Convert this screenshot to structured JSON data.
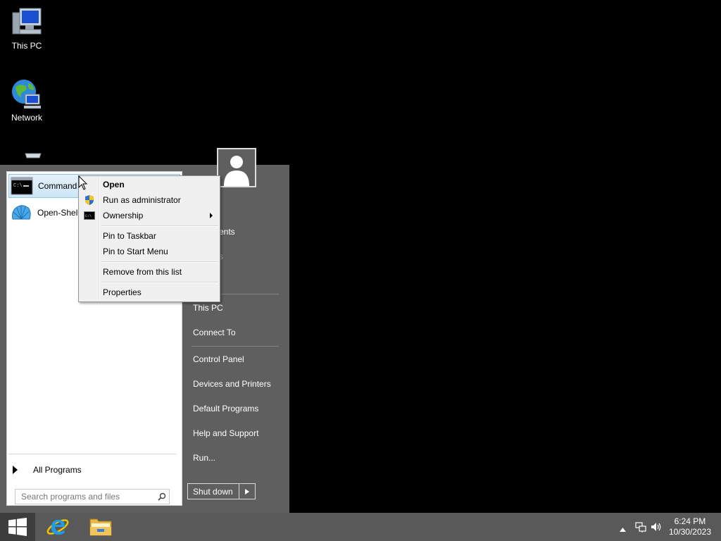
{
  "desktop": {
    "icons": [
      {
        "label": "This PC",
        "icon": "computer-icon"
      },
      {
        "label": "Network",
        "icon": "network-globe-icon"
      },
      {
        "label": "",
        "icon": "recycle-bin-icon"
      }
    ]
  },
  "start_menu": {
    "programs": [
      {
        "label": "Command",
        "icon": "command-prompt-icon",
        "selected": true
      },
      {
        "label": "Open-Shell",
        "icon": "open-shell-icon",
        "selected": false
      }
    ],
    "all_programs": "All Programs",
    "search": {
      "placeholder": "Search programs and files"
    },
    "right_items": {
      "documents_partial": "ents",
      "pictures_partial": "s",
      "this_pc": "This PC",
      "connect_to": "Connect To",
      "control_panel": "Control Panel",
      "devices_printers": "Devices and Printers",
      "default_programs": "Default Programs",
      "help_support": "Help and Support",
      "run": "Run..."
    },
    "shutdown": "Shut down"
  },
  "context_menu": {
    "open": "Open",
    "run_as_admin": "Run as administrator",
    "ownership": "Ownership",
    "pin_taskbar": "Pin to Taskbar",
    "pin_start": "Pin to Start Menu",
    "remove": "Remove from this list",
    "properties": "Properties"
  },
  "taskbar": {
    "pinned": [
      {
        "icon": "internet-explorer-icon"
      },
      {
        "icon": "file-explorer-icon"
      }
    ],
    "tray_icons": [
      "chevron-up-icon",
      "network-wired-icon",
      "volume-icon"
    ],
    "time": "6:24 PM",
    "date": "10/30/2023"
  },
  "colors": {
    "start_menu_bg": "#5f5f5f",
    "taskbar_bg": "#595959",
    "selection": "#cde6f7",
    "windows_blue": "#1e90ff"
  }
}
